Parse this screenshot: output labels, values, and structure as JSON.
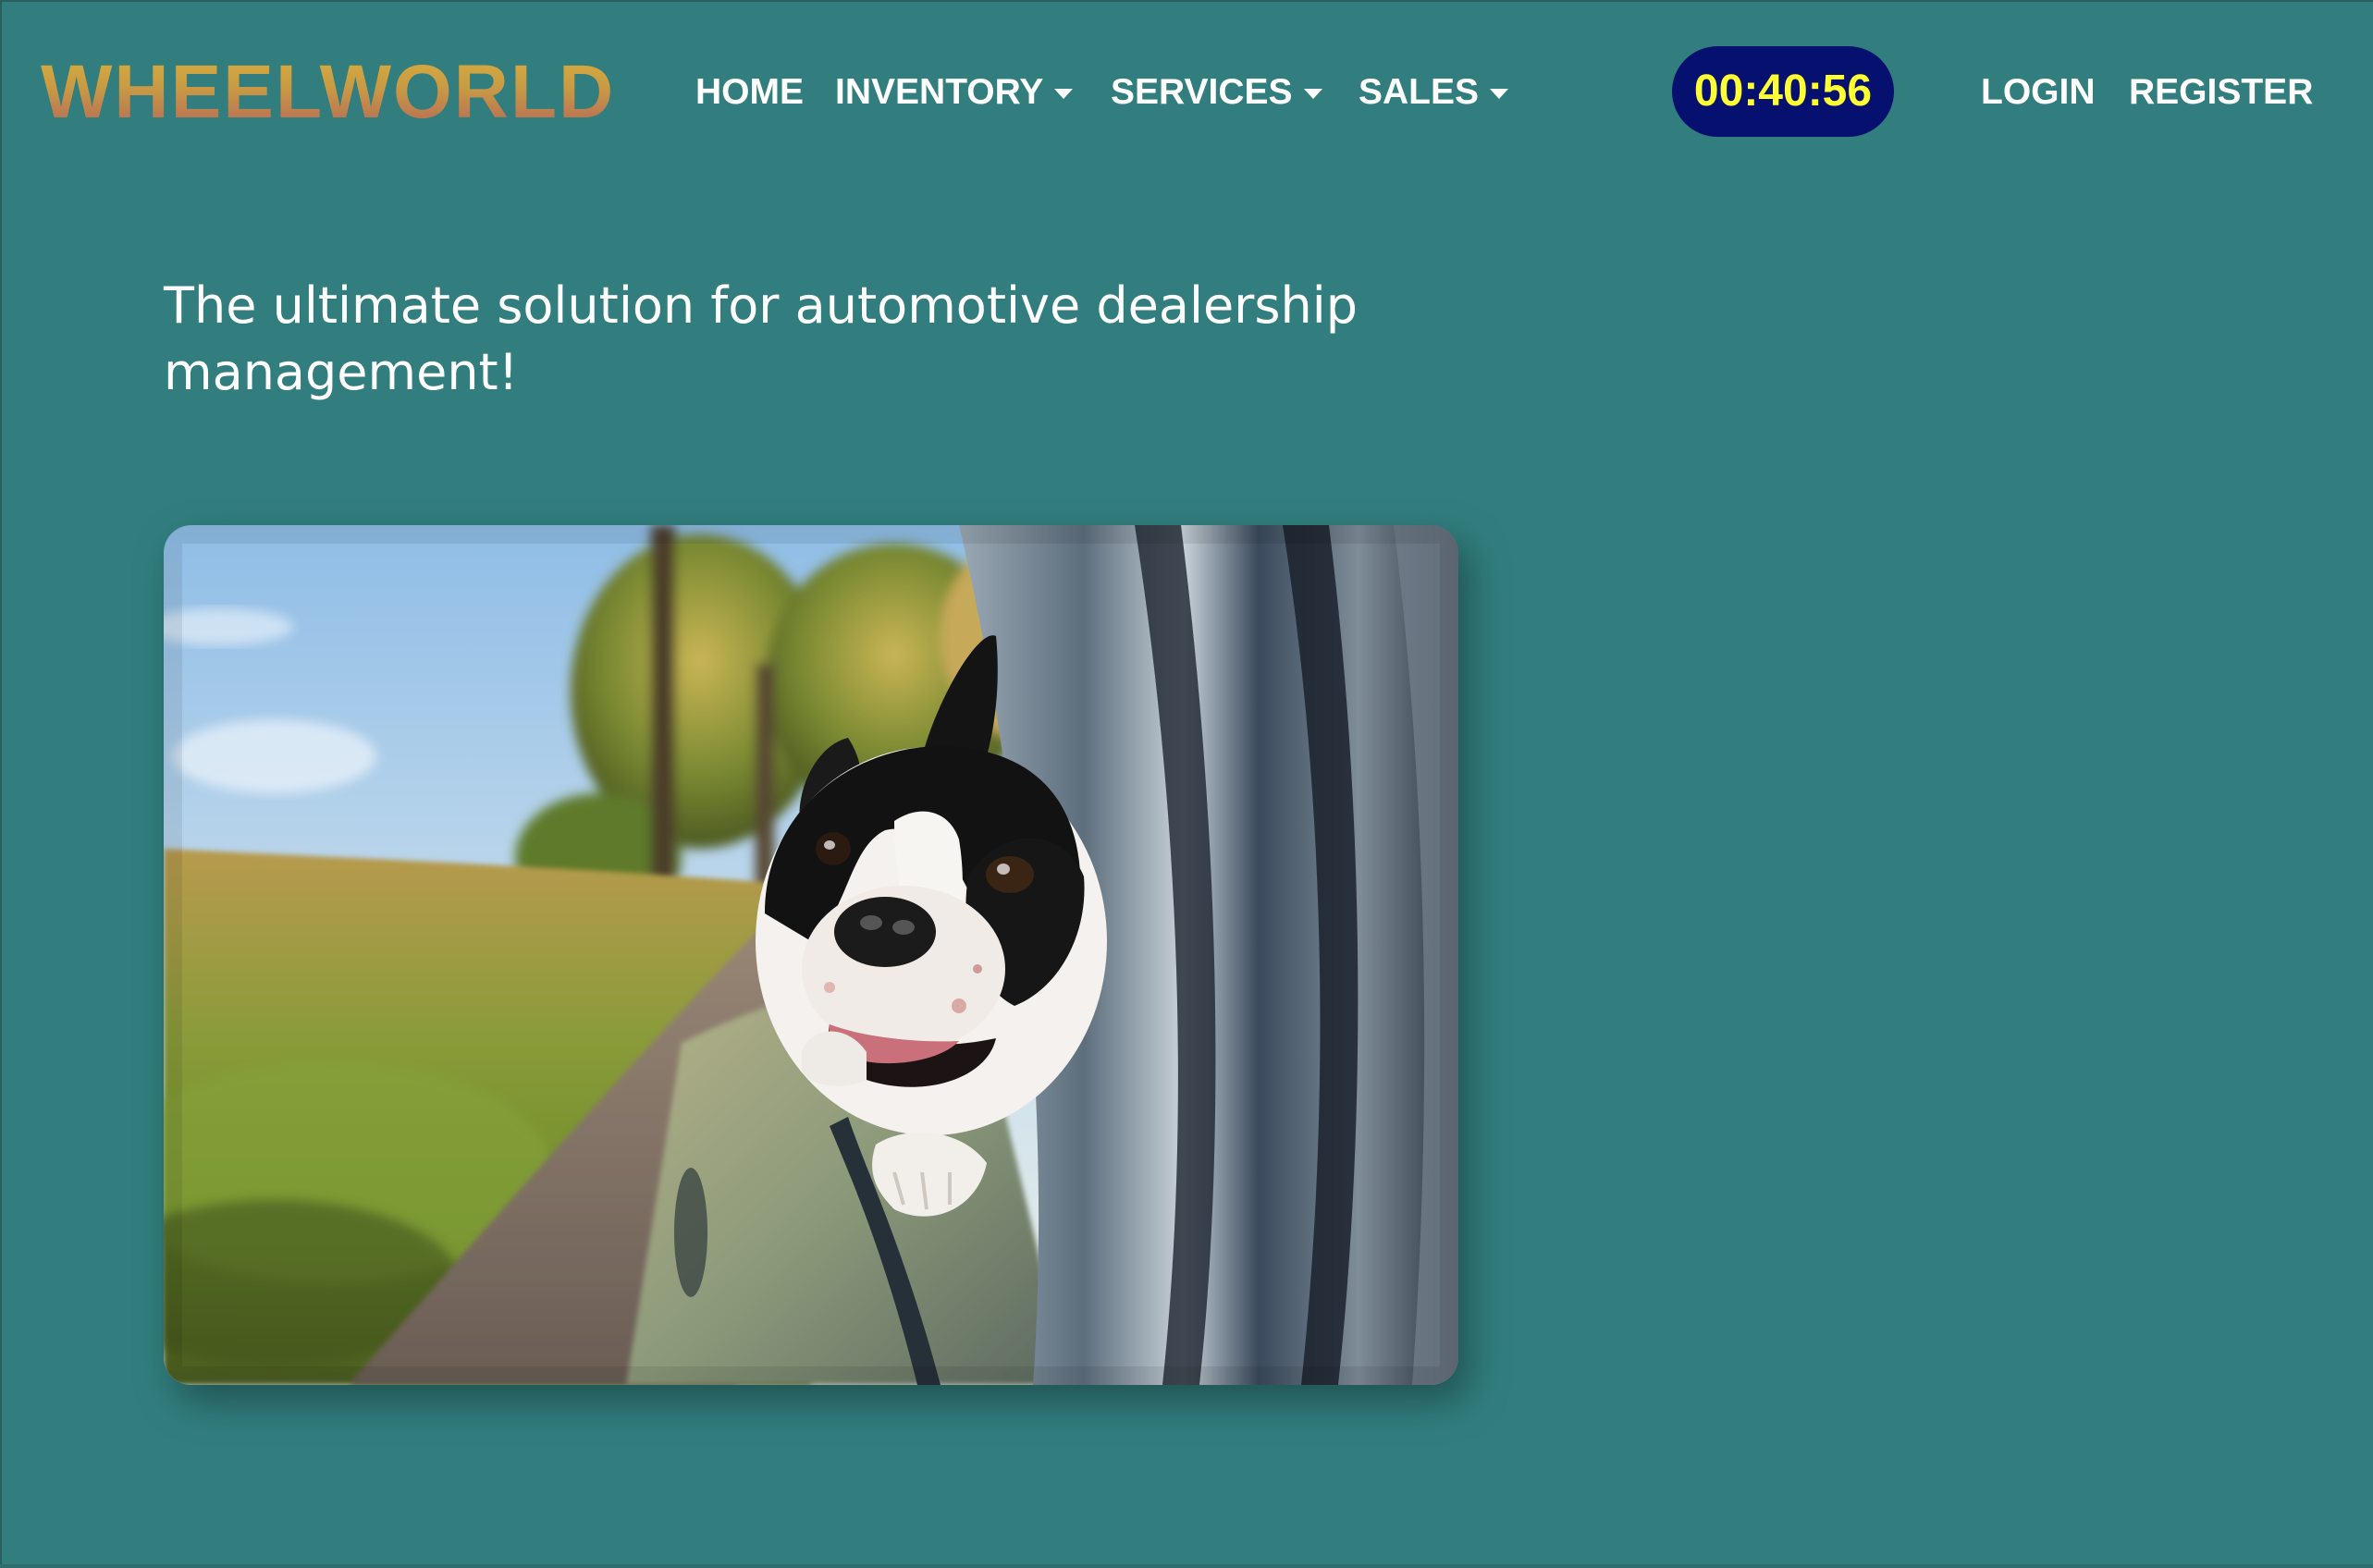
{
  "navbar": {
    "brand": "WHEELWORLD",
    "links": [
      {
        "label": "HOME",
        "dropdown": false
      },
      {
        "label": "INVENTORY",
        "dropdown": true
      },
      {
        "label": "SERVICES",
        "dropdown": true
      },
      {
        "label": "SALES",
        "dropdown": true
      }
    ],
    "timer": "00:40:56",
    "auth": {
      "login": "LOGIN",
      "register": "REGISTER"
    }
  },
  "main": {
    "tagline": "The ultimate solution for automotive dealership management!",
    "hero_image": "dog-in-car-window-photo"
  },
  "colors": {
    "background": "#327e7e",
    "timer_bg": "#06116f",
    "timer_text": "#ffff33",
    "brand_gradient_top": "#d8b13c",
    "brand_gradient_bottom": "#b2615a"
  }
}
